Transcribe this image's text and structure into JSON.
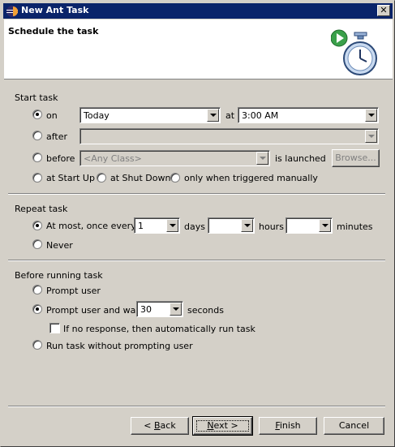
{
  "window": {
    "title": "New Ant Task"
  },
  "banner": {
    "title": "Schedule the task",
    "icon": "stopwatch-icon"
  },
  "start_task": {
    "heading": "Start task",
    "on": {
      "label": "on",
      "selected": true,
      "day_value": "Today",
      "at_label": "at",
      "time_value": "3:00 AM"
    },
    "after": {
      "label": "after",
      "selected": false,
      "value": ""
    },
    "before": {
      "label": "before",
      "selected": false,
      "class_value": "<Any Class>",
      "launched_label": "is launched",
      "browse_label": "Browse..."
    },
    "startup": {
      "label": "at Start Up",
      "selected": false
    },
    "shutdown": {
      "label": "at Shut Down",
      "selected": false
    },
    "manual": {
      "label": "only when triggered manually",
      "selected": false
    }
  },
  "repeat_task": {
    "heading": "Repeat task",
    "at_most": {
      "label": "At most, once every",
      "selected": true,
      "days_value": "1",
      "days_label": "days",
      "hours_value": "",
      "hours_label": "hours",
      "minutes_value": "",
      "minutes_label": "minutes"
    },
    "never": {
      "label": "Never",
      "selected": false
    }
  },
  "before_running": {
    "heading": "Before running task",
    "prompt_user": {
      "label": "Prompt user",
      "selected": false
    },
    "prompt_wait": {
      "label": "Prompt user and wait",
      "selected": true,
      "seconds_value": "30",
      "seconds_label": "seconds"
    },
    "auto_run": {
      "label": "If no response, then automatically run task",
      "checked": false
    },
    "run_without": {
      "label": "Run task without prompting user",
      "selected": false
    }
  },
  "buttons": {
    "back": {
      "prefix": "< ",
      "mnemonic": "B",
      "rest": "ack"
    },
    "next": {
      "mnemonic": "N",
      "rest": "ext >"
    },
    "finish": {
      "mnemonic": "F",
      "rest": "inish"
    },
    "cancel": "Cancel"
  },
  "colors": {
    "titlebar": "#0a246a",
    "dialog": "#d4d0c8"
  }
}
